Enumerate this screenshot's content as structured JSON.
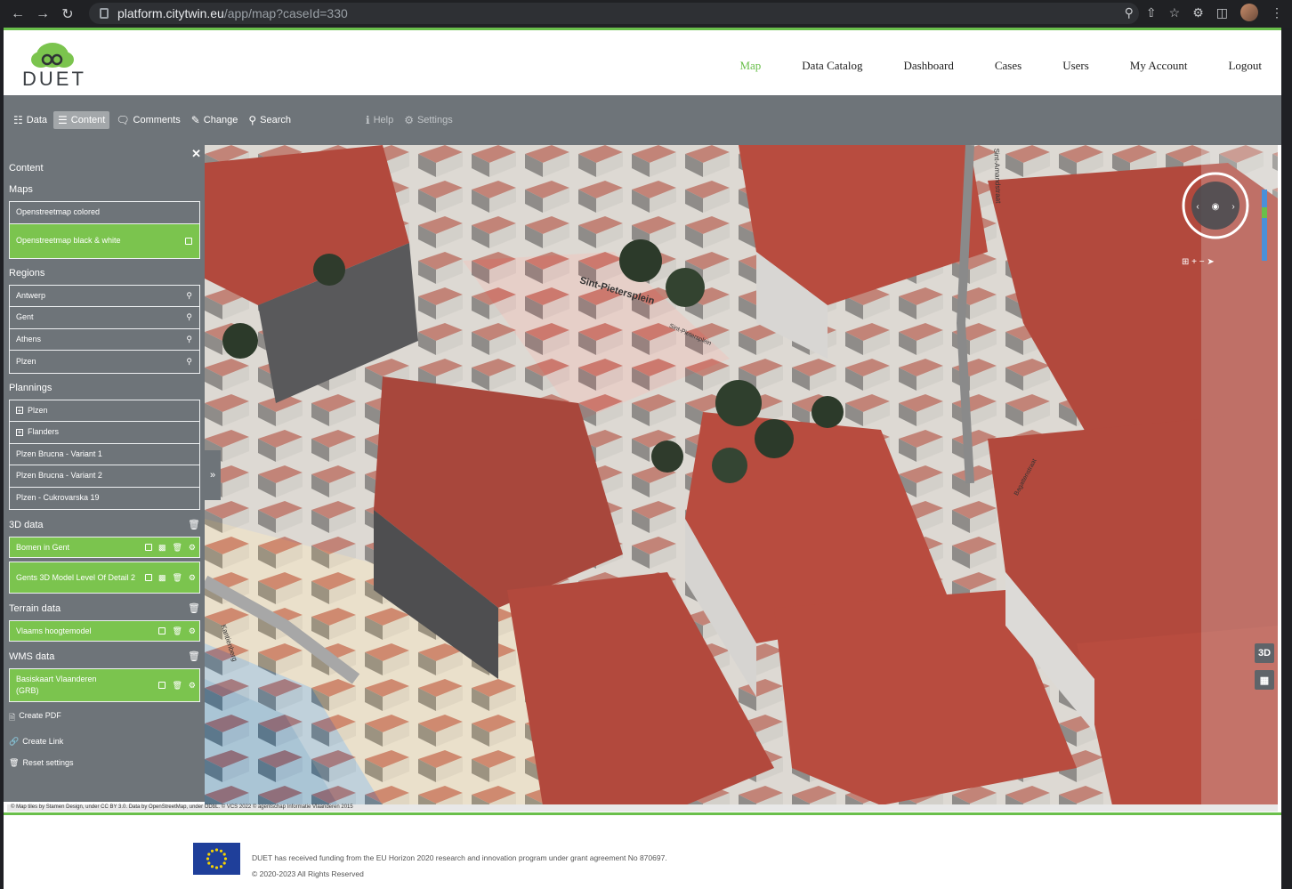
{
  "browser": {
    "url_host": "platform.citytwin.eu",
    "url_path": "/app/map?caseId=330"
  },
  "logo": {
    "text": "DUET"
  },
  "main_nav": [
    "Map",
    "Data Catalog",
    "Dashboard",
    "Cases",
    "Users",
    "My Account",
    "Logout"
  ],
  "toolbar": {
    "data": "Data",
    "content": "Content",
    "comments": "Comments",
    "change": "Change",
    "search": "Search",
    "help": "Help",
    "settings": "Settings"
  },
  "sidebar": {
    "title": "Content",
    "maps_label": "Maps",
    "maps": [
      "Openstreetmap colored",
      "Openstreetmap black & white"
    ],
    "regions_label": "Regions",
    "regions": [
      "Antwerp",
      "Gent",
      "Athens",
      "Plzen"
    ],
    "plannings_label": "Plannings",
    "plannings": [
      "Plzen",
      "Flanders",
      "Plzen Brucna - Variant 1",
      "Plzen Brucna - Variant 2",
      "Plzen - Cukrovarska 19"
    ],
    "data3d_label": "3D data",
    "data3d": [
      "Bomen in Gent",
      "Gents 3D Model Level Of Detail 2"
    ],
    "terrain_label": "Terrain data",
    "terrain": [
      "Vlaams hoogtemodel"
    ],
    "wms_label": "WMS data",
    "wms": [
      "Basiskaart Vlaanderen (GRB)"
    ],
    "create_pdf": "Create PDF",
    "create_link": "Create Link",
    "reset_settings": "Reset settings"
  },
  "map": {
    "label_3d": "3D",
    "street_labels": [
      "Sint-Pietersplein",
      "Sint-Pietersplein",
      "Kantienberg",
      "Bagattenstraat",
      "Sint-Amandstraat"
    ],
    "credits": "© Map tiles by Stamen Design, under CC BY 3.0. Data by OpenStreetMap, under ODbL.  © VCS 2022  © agentschap Informatie Vlaanderen 2015"
  },
  "footer": {
    "funding": "DUET has received funding from the EU Horizon 2020 research and innovation program under grant agreement No 870697.",
    "copyright": "© 2020-2023 All Rights Reserved"
  },
  "colors": {
    "brand_green": "#6abf4b",
    "toolbar_gray": "#6e7479",
    "item_green": "#7bc44e",
    "roof_red": "#b2493d"
  }
}
